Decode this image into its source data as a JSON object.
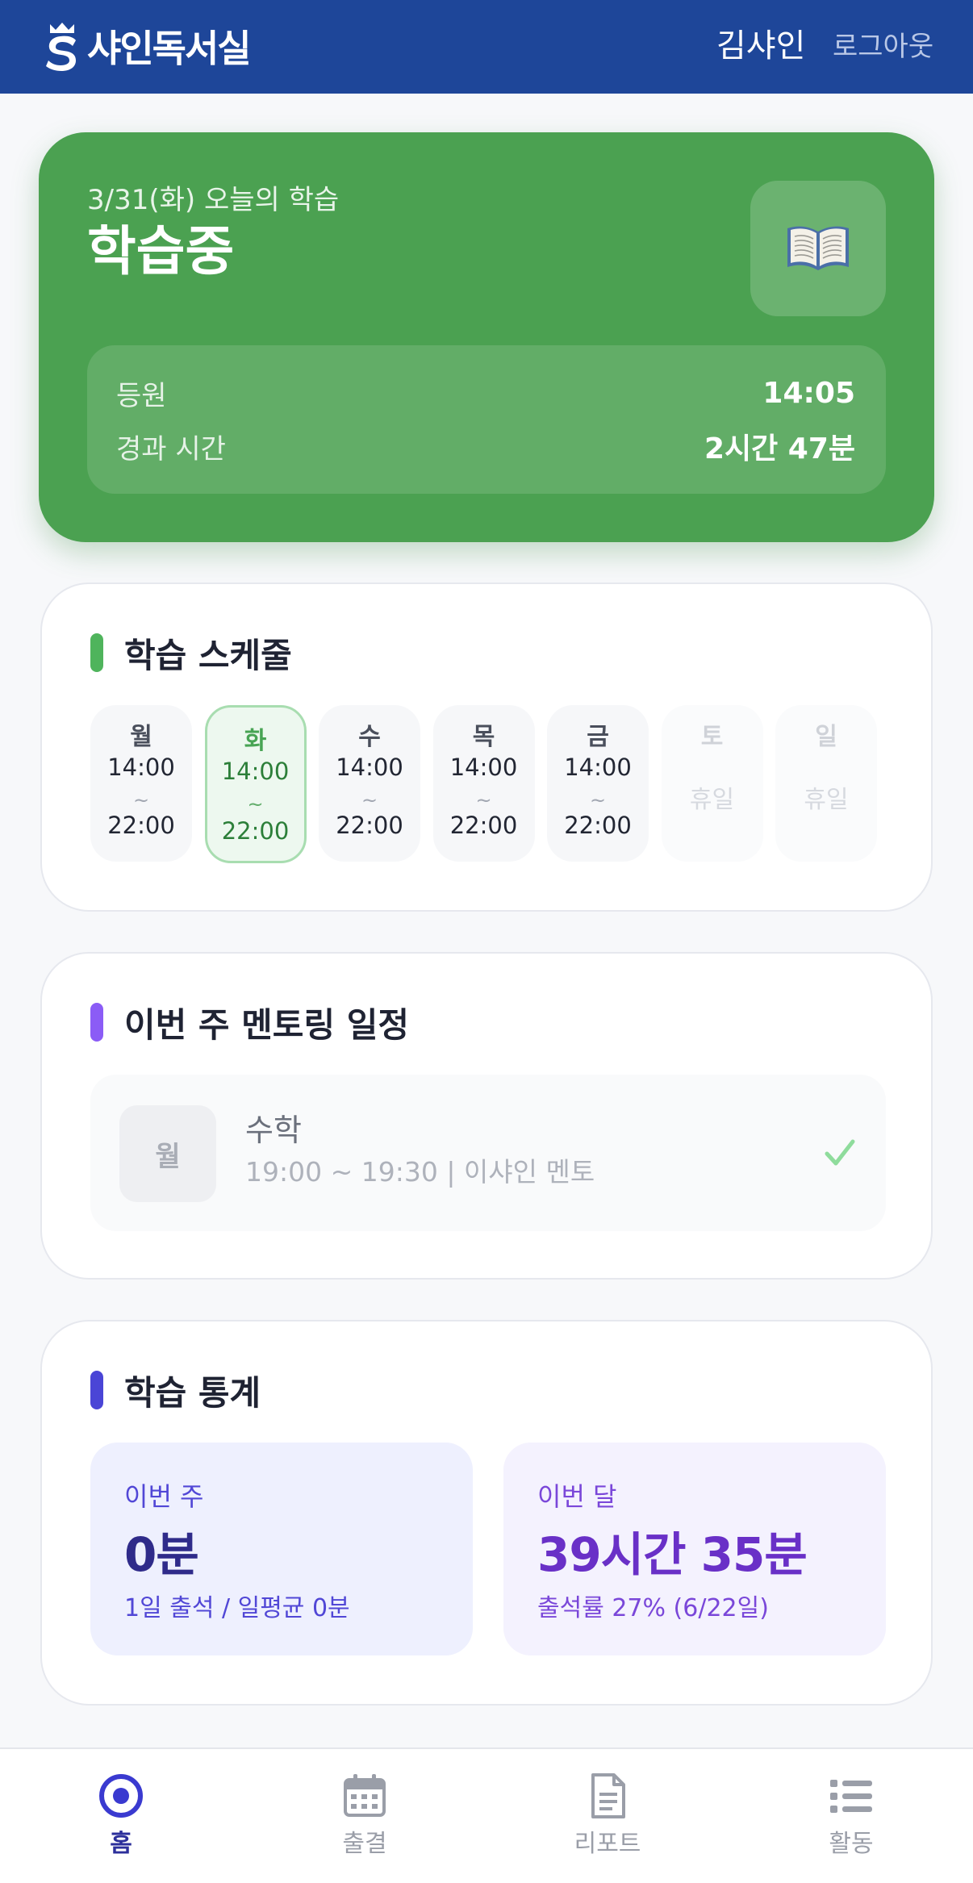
{
  "header": {
    "logo_text": "샤인독서실",
    "user_name": "김샤인",
    "logout_label": "로그아웃"
  },
  "today": {
    "subtitle": "3/31(화) 오늘의 학습",
    "status": "학습중",
    "icon": "open-book-icon",
    "checkin_label": "등원",
    "checkin_time": "14:05",
    "elapsed_label": "경과 시간",
    "elapsed_value": "2시간 47분"
  },
  "schedule": {
    "title": "학습 스케줄",
    "accent_color": "#4fb45c",
    "days": [
      {
        "day": "월",
        "start": "14:00",
        "sep": "~",
        "end": "22:00"
      },
      {
        "day": "화",
        "start": "14:00",
        "sep": "~",
        "end": "22:00",
        "today": true
      },
      {
        "day": "수",
        "start": "14:00",
        "sep": "~",
        "end": "22:00"
      },
      {
        "day": "목",
        "start": "14:00",
        "sep": "~",
        "end": "22:00"
      },
      {
        "day": "금",
        "start": "14:00",
        "sep": "~",
        "end": "22:00"
      },
      {
        "day": "토",
        "off_label": "휴일"
      },
      {
        "day": "일",
        "off_label": "휴일"
      }
    ]
  },
  "mentoring": {
    "title": "이번 주 멘토링 일정",
    "accent_color": "#8b5cf6",
    "items": [
      {
        "day": "월",
        "subject": "수학",
        "info": "19:00 ~ 19:30 | 이샤인 멘토",
        "status_icon": "check-icon"
      }
    ]
  },
  "stats": {
    "title": "학습 통계",
    "accent_color": "#4a45d6",
    "week": {
      "label": "이번 주",
      "value": "0분",
      "sub": "1일 출석 / 일평균 0분"
    },
    "month": {
      "label": "이번 달",
      "value": "39시간 35분",
      "sub": "출석률 27% (6/22일)"
    }
  },
  "nav": {
    "items": [
      {
        "label": "홈",
        "icon": "home-target-icon",
        "active": true
      },
      {
        "label": "출결",
        "icon": "calendar-icon"
      },
      {
        "label": "리포트",
        "icon": "document-icon"
      },
      {
        "label": "활동",
        "icon": "list-icon"
      }
    ]
  }
}
